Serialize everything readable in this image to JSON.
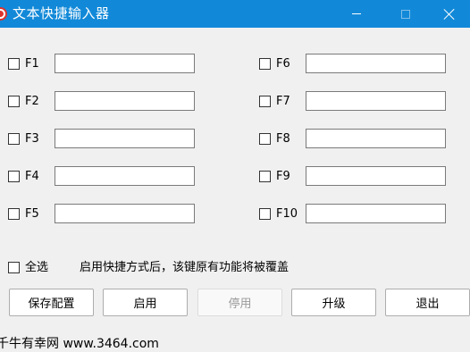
{
  "window": {
    "title": "文本快捷输入器",
    "accent": "#1289d8"
  },
  "hotkeys": {
    "left": [
      {
        "label": "F1",
        "value": ""
      },
      {
        "label": "F2",
        "value": ""
      },
      {
        "label": "F3",
        "value": ""
      },
      {
        "label": "F4",
        "value": ""
      },
      {
        "label": "F5",
        "value": ""
      }
    ],
    "right": [
      {
        "label": "F6",
        "value": ""
      },
      {
        "label": "F7",
        "value": ""
      },
      {
        "label": "F8",
        "value": ""
      },
      {
        "label": "F9",
        "value": ""
      },
      {
        "label": "F10",
        "value": ""
      }
    ]
  },
  "select_all": {
    "label": "全选",
    "checked": false
  },
  "hint": "启用快捷方式后，该键原有功能将被覆盖",
  "buttons": {
    "save": "保存配置",
    "enable": "启用",
    "disable": "停用",
    "upgrade": "升级",
    "exit": "退出"
  },
  "watermark": "千牛有幸网 www.3464.com"
}
